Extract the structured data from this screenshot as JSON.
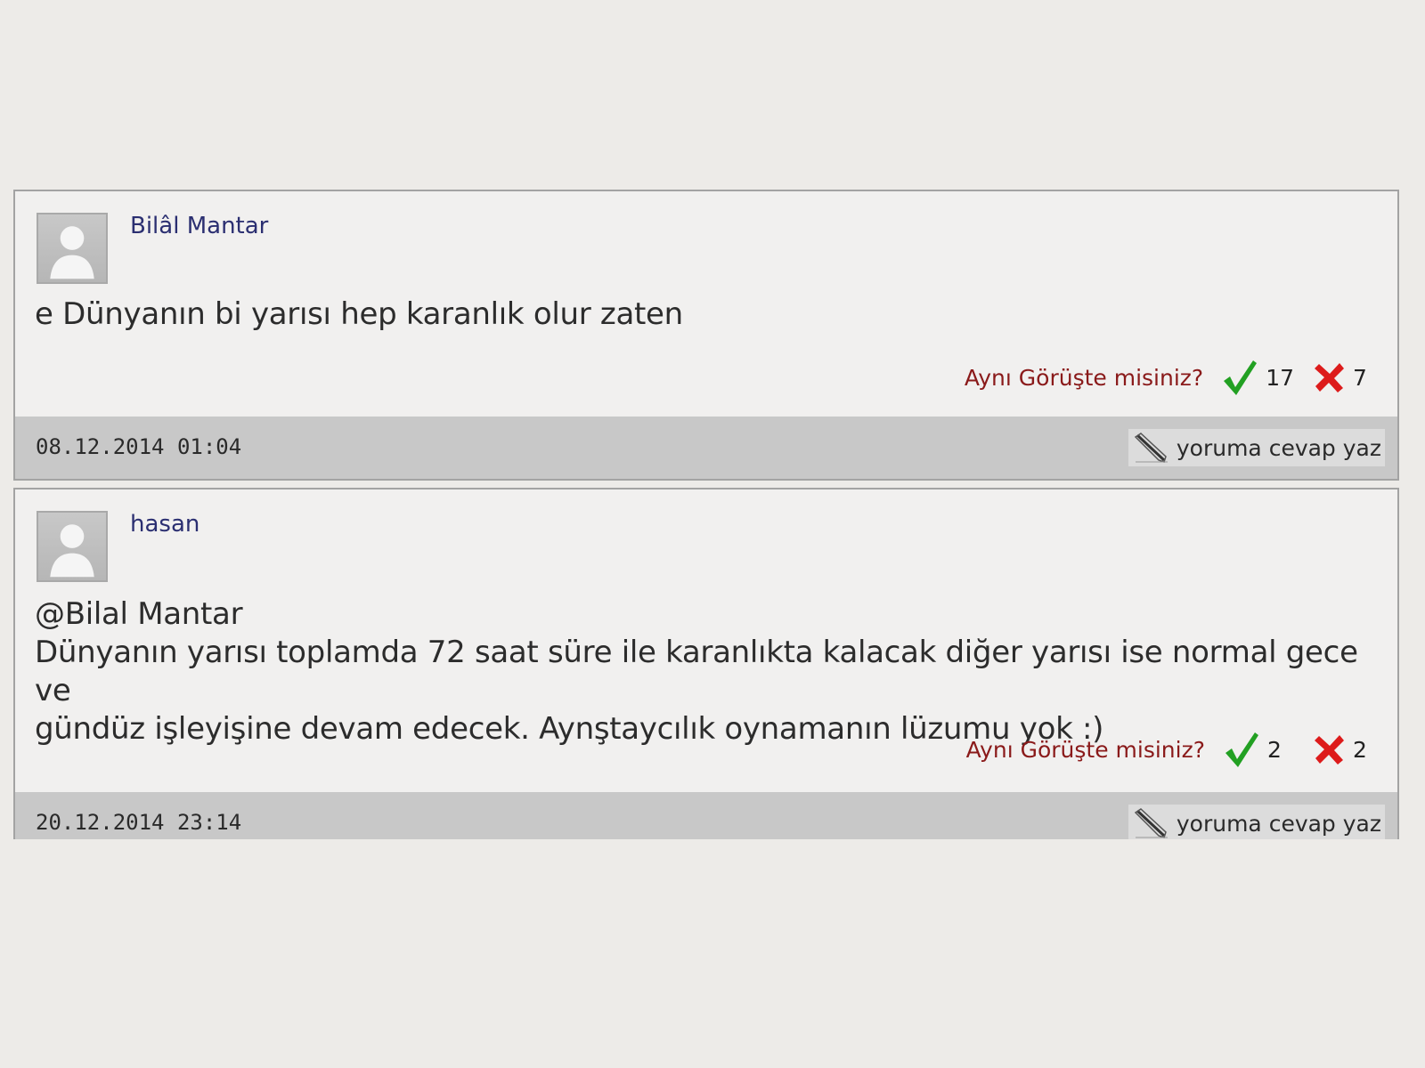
{
  "vote_question": "Aynı Görüşte misiniz?",
  "reply_label": "yoruma cevap yaz",
  "colors": {
    "author": "#2b2f71",
    "vote_question": "#8a1a1a",
    "check": "#22a022",
    "cross": "#dd1b1b",
    "footer": "#c8c8c8"
  },
  "icons": {
    "avatar": "default-user-avatar",
    "up": "check-icon",
    "down": "cross-icon",
    "reply": "pencil-icon"
  },
  "comments": [
    {
      "author": "Bilâl Mantar",
      "text": "e Dünyanın bi yarısı hep karanlık olur zaten",
      "upvotes": "17",
      "downvotes": "7",
      "date": "08.12.2014 01:04"
    },
    {
      "author": "hasan",
      "text": "@Bilal Mantar\nDünyanın yarısı toplamda 72 saat süre ile karanlıkta kalacak diğer yarısı ise normal gece ve\ngündüz işleyişine devam edecek. Aynştaycılık oynamanın lüzumu yok :)",
      "upvotes": "2",
      "downvotes": "2",
      "date": "20.12.2014 23:14"
    }
  ]
}
